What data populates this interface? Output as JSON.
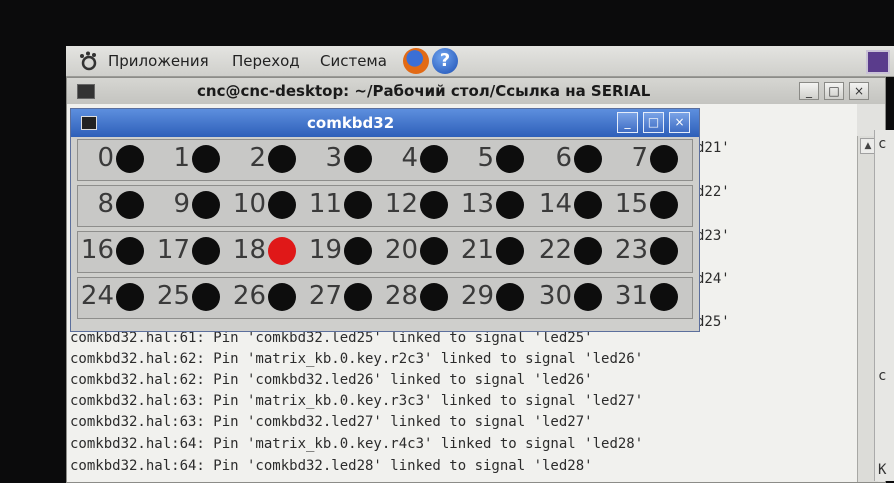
{
  "panel": {
    "menu_apps": "Приложения",
    "menu_places": "Переход",
    "menu_system": "Система"
  },
  "terminal": {
    "title": "cnc@cnc-desktop: ~/Рабочий стол/Ссылка на SERIAL",
    "right_cut": [
      "d21'",
      "d22'",
      "d23'",
      "d24'",
      "d25'"
    ],
    "strip_text": [
      "c",
      "c",
      "K"
    ],
    "log_lines": [
      "comkbd32.hal:61: Pin 'comkbd32.led25' linked to signal 'led25'",
      "comkbd32.hal:62: Pin 'matrix_kb.0.key.r2c3' linked to signal 'led26'",
      "comkbd32.hal:62: Pin 'comkbd32.led26' linked to signal 'led26'",
      "comkbd32.hal:63: Pin 'matrix_kb.0.key.r3c3' linked to signal 'led27'",
      "comkbd32.hal:63: Pin 'comkbd32.led27' linked to signal 'led27'",
      "comkbd32.hal:64: Pin 'matrix_kb.0.key.r4c3' linked to signal 'led28'",
      "comkbd32.hal:64: Pin 'comkbd32.led28' linked to signal 'led28'"
    ]
  },
  "kbd_window": {
    "title": "comkbd32",
    "led_on_color": "#e01818",
    "led_off_color": "#0d0d0d",
    "rows": [
      [
        {
          "n": "0",
          "on": false
        },
        {
          "n": "1",
          "on": false
        },
        {
          "n": "2",
          "on": false
        },
        {
          "n": "3",
          "on": false
        },
        {
          "n": "4",
          "on": false
        },
        {
          "n": "5",
          "on": false
        },
        {
          "n": "6",
          "on": false
        },
        {
          "n": "7",
          "on": false
        }
      ],
      [
        {
          "n": "8",
          "on": false
        },
        {
          "n": "9",
          "on": false
        },
        {
          "n": "10",
          "on": false
        },
        {
          "n": "11",
          "on": false
        },
        {
          "n": "12",
          "on": false
        },
        {
          "n": "13",
          "on": false
        },
        {
          "n": "14",
          "on": false
        },
        {
          "n": "15",
          "on": false
        }
      ],
      [
        {
          "n": "16",
          "on": false
        },
        {
          "n": "17",
          "on": false
        },
        {
          "n": "18",
          "on": true
        },
        {
          "n": "19",
          "on": false
        },
        {
          "n": "20",
          "on": false
        },
        {
          "n": "21",
          "on": false
        },
        {
          "n": "22",
          "on": false
        },
        {
          "n": "23",
          "on": false
        }
      ],
      [
        {
          "n": "24",
          "on": false
        },
        {
          "n": "25",
          "on": false
        },
        {
          "n": "26",
          "on": false
        },
        {
          "n": "27",
          "on": false
        },
        {
          "n": "28",
          "on": false
        },
        {
          "n": "29",
          "on": false
        },
        {
          "n": "30",
          "on": false
        },
        {
          "n": "31",
          "on": false
        }
      ]
    ]
  }
}
